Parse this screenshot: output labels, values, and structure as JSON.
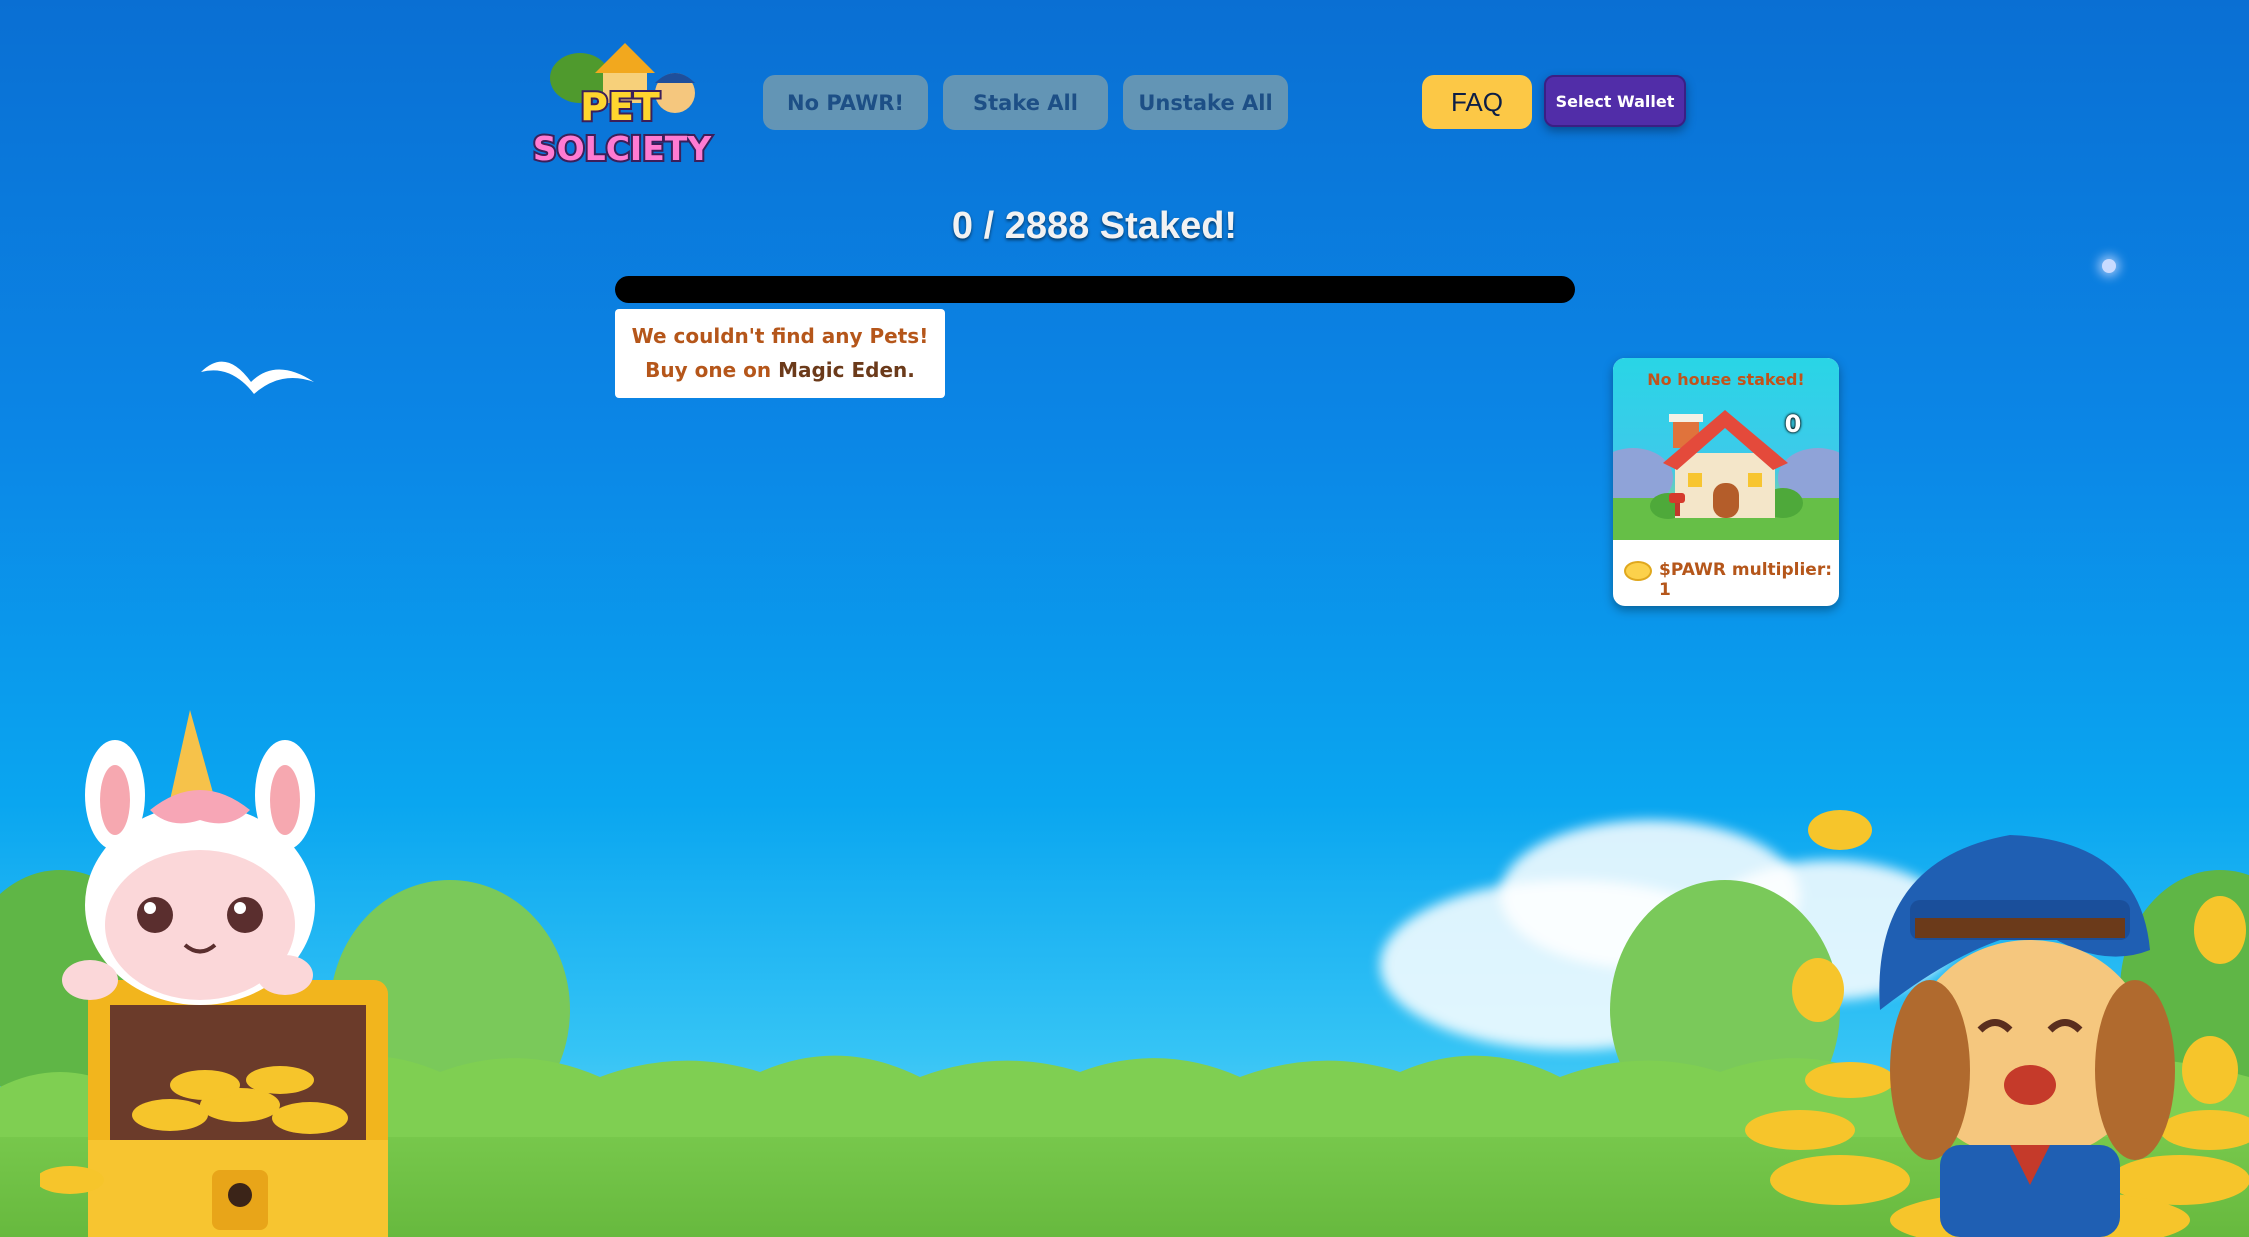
{
  "header": {
    "logo_text_top": "PET",
    "logo_text_bottom": "SOLCIETY",
    "buttons": {
      "no_pawr": "No PAWR!",
      "stake_all": "Stake All",
      "unstake_all": "Unstake All",
      "faq": "FAQ",
      "select_wallet": "Select Wallet"
    }
  },
  "staking": {
    "title": "0 / 2888 Staked!",
    "progress_fraction": 0
  },
  "notice": {
    "text": "We couldn't find any Pets! Buy one on",
    "link": "Magic Eden."
  },
  "house_card": {
    "label": "No house staked!",
    "count": "0",
    "multiplier": "$PAWR multiplier: 1"
  },
  "colors": {
    "sky_top": "#0a6fd3",
    "accent_yellow": "#fcc846",
    "wallet_purple": "#512da8",
    "notice_text": "#b5561a"
  }
}
